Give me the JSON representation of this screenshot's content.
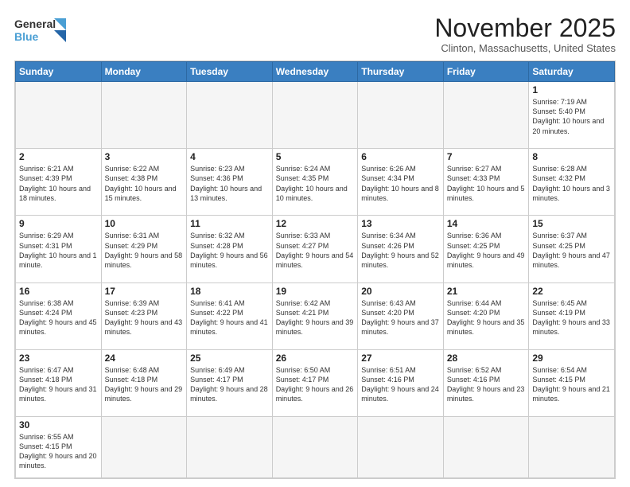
{
  "header": {
    "logo_general": "General",
    "logo_blue": "Blue",
    "month_title": "November 2025",
    "location": "Clinton, Massachusetts, United States"
  },
  "days_of_week": [
    "Sunday",
    "Monday",
    "Tuesday",
    "Wednesday",
    "Thursday",
    "Friday",
    "Saturday"
  ],
  "weeks": [
    [
      {
        "day": "",
        "info": ""
      },
      {
        "day": "",
        "info": ""
      },
      {
        "day": "",
        "info": ""
      },
      {
        "day": "",
        "info": ""
      },
      {
        "day": "",
        "info": ""
      },
      {
        "day": "",
        "info": ""
      },
      {
        "day": "1",
        "info": "Sunrise: 7:19 AM\nSunset: 5:40 PM\nDaylight: 10 hours and 20 minutes."
      }
    ],
    [
      {
        "day": "2",
        "info": "Sunrise: 6:21 AM\nSunset: 4:39 PM\nDaylight: 10 hours and 18 minutes."
      },
      {
        "day": "3",
        "info": "Sunrise: 6:22 AM\nSunset: 4:38 PM\nDaylight: 10 hours and 15 minutes."
      },
      {
        "day": "4",
        "info": "Sunrise: 6:23 AM\nSunset: 4:36 PM\nDaylight: 10 hours and 13 minutes."
      },
      {
        "day": "5",
        "info": "Sunrise: 6:24 AM\nSunset: 4:35 PM\nDaylight: 10 hours and 10 minutes."
      },
      {
        "day": "6",
        "info": "Sunrise: 6:26 AM\nSunset: 4:34 PM\nDaylight: 10 hours and 8 minutes."
      },
      {
        "day": "7",
        "info": "Sunrise: 6:27 AM\nSunset: 4:33 PM\nDaylight: 10 hours and 5 minutes."
      },
      {
        "day": "8",
        "info": "Sunrise: 6:28 AM\nSunset: 4:32 PM\nDaylight: 10 hours and 3 minutes."
      }
    ],
    [
      {
        "day": "9",
        "info": "Sunrise: 6:29 AM\nSunset: 4:31 PM\nDaylight: 10 hours and 1 minute."
      },
      {
        "day": "10",
        "info": "Sunrise: 6:31 AM\nSunset: 4:29 PM\nDaylight: 9 hours and 58 minutes."
      },
      {
        "day": "11",
        "info": "Sunrise: 6:32 AM\nSunset: 4:28 PM\nDaylight: 9 hours and 56 minutes."
      },
      {
        "day": "12",
        "info": "Sunrise: 6:33 AM\nSunset: 4:27 PM\nDaylight: 9 hours and 54 minutes."
      },
      {
        "day": "13",
        "info": "Sunrise: 6:34 AM\nSunset: 4:26 PM\nDaylight: 9 hours and 52 minutes."
      },
      {
        "day": "14",
        "info": "Sunrise: 6:36 AM\nSunset: 4:25 PM\nDaylight: 9 hours and 49 minutes."
      },
      {
        "day": "15",
        "info": "Sunrise: 6:37 AM\nSunset: 4:25 PM\nDaylight: 9 hours and 47 minutes."
      }
    ],
    [
      {
        "day": "16",
        "info": "Sunrise: 6:38 AM\nSunset: 4:24 PM\nDaylight: 9 hours and 45 minutes."
      },
      {
        "day": "17",
        "info": "Sunrise: 6:39 AM\nSunset: 4:23 PM\nDaylight: 9 hours and 43 minutes."
      },
      {
        "day": "18",
        "info": "Sunrise: 6:41 AM\nSunset: 4:22 PM\nDaylight: 9 hours and 41 minutes."
      },
      {
        "day": "19",
        "info": "Sunrise: 6:42 AM\nSunset: 4:21 PM\nDaylight: 9 hours and 39 minutes."
      },
      {
        "day": "20",
        "info": "Sunrise: 6:43 AM\nSunset: 4:20 PM\nDaylight: 9 hours and 37 minutes."
      },
      {
        "day": "21",
        "info": "Sunrise: 6:44 AM\nSunset: 4:20 PM\nDaylight: 9 hours and 35 minutes."
      },
      {
        "day": "22",
        "info": "Sunrise: 6:45 AM\nSunset: 4:19 PM\nDaylight: 9 hours and 33 minutes."
      }
    ],
    [
      {
        "day": "23",
        "info": "Sunrise: 6:47 AM\nSunset: 4:18 PM\nDaylight: 9 hours and 31 minutes."
      },
      {
        "day": "24",
        "info": "Sunrise: 6:48 AM\nSunset: 4:18 PM\nDaylight: 9 hours and 29 minutes."
      },
      {
        "day": "25",
        "info": "Sunrise: 6:49 AM\nSunset: 4:17 PM\nDaylight: 9 hours and 28 minutes."
      },
      {
        "day": "26",
        "info": "Sunrise: 6:50 AM\nSunset: 4:17 PM\nDaylight: 9 hours and 26 minutes."
      },
      {
        "day": "27",
        "info": "Sunrise: 6:51 AM\nSunset: 4:16 PM\nDaylight: 9 hours and 24 minutes."
      },
      {
        "day": "28",
        "info": "Sunrise: 6:52 AM\nSunset: 4:16 PM\nDaylight: 9 hours and 23 minutes."
      },
      {
        "day": "29",
        "info": "Sunrise: 6:54 AM\nSunset: 4:15 PM\nDaylight: 9 hours and 21 minutes."
      }
    ],
    [
      {
        "day": "30",
        "info": "Sunrise: 6:55 AM\nSunset: 4:15 PM\nDaylight: 9 hours and 20 minutes."
      },
      {
        "day": "",
        "info": ""
      },
      {
        "day": "",
        "info": ""
      },
      {
        "day": "",
        "info": ""
      },
      {
        "day": "",
        "info": ""
      },
      {
        "day": "",
        "info": ""
      },
      {
        "day": "",
        "info": ""
      }
    ]
  ]
}
